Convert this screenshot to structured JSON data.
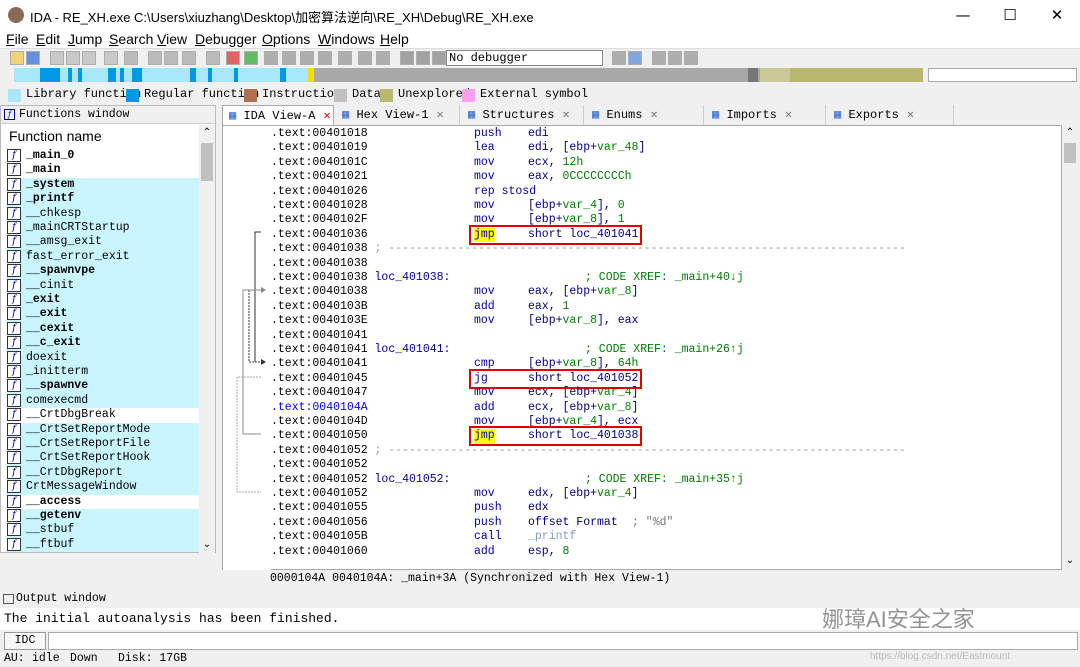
{
  "window": {
    "title": "IDA - RE_XH.exe C:\\Users\\xiuzhang\\Desktop\\加密算法逆向\\RE_XH\\Debug\\RE_XH.exe",
    "minimize": "—",
    "maximize": "☐",
    "close": "✕"
  },
  "menu": [
    {
      "label": "File",
      "u": "F",
      "rest": "ile"
    },
    {
      "label": "Edit",
      "u": "E",
      "rest": "dit"
    },
    {
      "label": "Jump",
      "u": "J",
      "rest": "ump"
    },
    {
      "label": "Search",
      "u": "S",
      "rest": "earch"
    },
    {
      "label": "View",
      "u": "V",
      "rest": "iew"
    },
    {
      "label": "Debugger",
      "u": "D",
      "rest": "ebugger"
    },
    {
      "label": "Options",
      "u": "O",
      "rest": "ptions"
    },
    {
      "label": "Windows",
      "u": "W",
      "rest": "indows"
    },
    {
      "label": "Help",
      "u": "H",
      "rest": "elp"
    }
  ],
  "toolbar": {
    "debugger_select": "No debugger"
  },
  "legend": [
    {
      "label": "Library function",
      "color": "#a8e8f8"
    },
    {
      "label": "Regular function",
      "color": "#0099e6"
    },
    {
      "label": "Instruction",
      "color": "#b07050"
    },
    {
      "label": "Data",
      "color": "#c0c0c0"
    },
    {
      "label": "Unexplored",
      "color": "#b8b870"
    },
    {
      "label": "External symbol",
      "color": "#ff9ff0"
    }
  ],
  "functions_window": {
    "title": "Functions window",
    "header": "Function name",
    "items": [
      {
        "name": "_main_0",
        "lib": false,
        "bold": true
      },
      {
        "name": "_main",
        "lib": false,
        "bold": true
      },
      {
        "name": "_system",
        "lib": true,
        "bold": true
      },
      {
        "name": "_printf",
        "lib": true,
        "bold": true
      },
      {
        "name": "__chkesp",
        "lib": true,
        "bold": false
      },
      {
        "name": "_mainCRTStartup",
        "lib": true,
        "bold": false
      },
      {
        "name": "__amsg_exit",
        "lib": true,
        "bold": false
      },
      {
        "name": "fast_error_exit",
        "lib": true,
        "bold": false
      },
      {
        "name": "__spawnvpe",
        "lib": true,
        "bold": true
      },
      {
        "name": "__cinit",
        "lib": true,
        "bold": false
      },
      {
        "name": "_exit",
        "lib": true,
        "bold": true
      },
      {
        "name": "__exit",
        "lib": true,
        "bold": true
      },
      {
        "name": "__cexit",
        "lib": true,
        "bold": true
      },
      {
        "name": "__c_exit",
        "lib": true,
        "bold": true
      },
      {
        "name": "doexit",
        "lib": true,
        "bold": false
      },
      {
        "name": "_initterm",
        "lib": true,
        "bold": false
      },
      {
        "name": "__spawnve",
        "lib": true,
        "bold": true
      },
      {
        "name": "comexecmd",
        "lib": true,
        "bold": false
      },
      {
        "name": "__CrtDbgBreak",
        "lib": false,
        "bold": false
      },
      {
        "name": "__CrtSetReportMode",
        "lib": true,
        "bold": false
      },
      {
        "name": "__CrtSetReportFile",
        "lib": true,
        "bold": false
      },
      {
        "name": "__CrtSetReportHook",
        "lib": true,
        "bold": false
      },
      {
        "name": "__CrtDbgReport",
        "lib": true,
        "bold": false
      },
      {
        "name": "CrtMessageWindow",
        "lib": true,
        "bold": false
      },
      {
        "name": "__access",
        "lib": false,
        "bold": true
      },
      {
        "name": "__getenv",
        "lib": true,
        "bold": true
      },
      {
        "name": "__stbuf",
        "lib": true,
        "bold": false
      },
      {
        "name": "__ftbuf",
        "lib": true,
        "bold": false
      }
    ]
  },
  "tabs": [
    {
      "label": "IDA View-A",
      "close": "✕",
      "active": true
    },
    {
      "label": "Hex View-1",
      "close": "✕",
      "active": false
    },
    {
      "label": "Structures",
      "close": "✕",
      "active": false
    },
    {
      "label": "Enums",
      "close": "✕",
      "active": false
    },
    {
      "label": "Imports",
      "close": "✕",
      "active": false
    },
    {
      "label": "Exports",
      "close": "✕",
      "active": false
    }
  ],
  "code": [
    {
      "addr": ".text:00401018",
      "mn": "push",
      "op": "edi"
    },
    {
      "addr": ".text:00401019",
      "mn": "lea",
      "op": "edi, [ebp+var_48]"
    },
    {
      "addr": ".text:0040101C",
      "mn": "mov",
      "op": "ecx, 12h"
    },
    {
      "addr": ".text:00401021",
      "mn": "mov",
      "op": "eax, 0CCCCCCCCh"
    },
    {
      "addr": ".text:00401026",
      "mn": "rep stosd",
      "op": ""
    },
    {
      "addr": ".text:00401028",
      "mn": "mov",
      "op": "[ebp+var_4], 0"
    },
    {
      "addr": ".text:0040102F",
      "mn": "mov",
      "op": "[ebp+var_8], 1"
    },
    {
      "addr": ".text:00401036",
      "mn": "jmp",
      "op": "short loc_401041",
      "hl": true,
      "box": true
    },
    {
      "addr": ".text:00401038",
      "sep": "; ---------------------------------------------------------------------------"
    },
    {
      "addr": ".text:00401038"
    },
    {
      "addr": ".text:00401038",
      "label": "loc_401038:",
      "cmt": "; CODE XREF: _main+40↓j"
    },
    {
      "addr": ".text:00401038",
      "mn": "mov",
      "op": "eax, [ebp+var_8]"
    },
    {
      "addr": ".text:0040103B",
      "mn": "add",
      "op": "eax, 1"
    },
    {
      "addr": ".text:0040103E",
      "mn": "mov",
      "op": "[ebp+var_8], eax"
    },
    {
      "addr": ".text:00401041"
    },
    {
      "addr": ".text:00401041",
      "label": "loc_401041:",
      "cmt": "; CODE XREF: _main+26↑j"
    },
    {
      "addr": ".text:00401041",
      "mn": "cmp",
      "op": "[ebp+var_8], 64h"
    },
    {
      "addr": ".text:00401045",
      "mn": "jg",
      "op": "short loc_401052",
      "box": true
    },
    {
      "addr": ".text:00401047",
      "mn": "mov",
      "op": "ecx, [ebp+var_4]"
    },
    {
      "addr": ".text:0040104A",
      "mn": "add",
      "op": "ecx, [ebp+var_8]",
      "blue": true
    },
    {
      "addr": ".text:0040104D",
      "mn": "mov",
      "op": "[ebp+var_4], ecx"
    },
    {
      "addr": ".text:00401050",
      "mn": "jmp",
      "op": "short loc_401038",
      "hl": true,
      "box": true
    },
    {
      "addr": ".text:00401052",
      "sep": "; ---------------------------------------------------------------------------"
    },
    {
      "addr": ".text:00401052"
    },
    {
      "addr": ".text:00401052",
      "label": "loc_401052:",
      "cmt": "; CODE XREF: _main+35↑j"
    },
    {
      "addr": ".text:00401052",
      "mn": "mov",
      "op": "edx, [ebp+var_4]"
    },
    {
      "addr": ".text:00401055",
      "mn": "push",
      "op": "edx"
    },
    {
      "addr": ".text:00401056",
      "mn": "push",
      "op": "offset Format",
      "cmt2": "; \"%d\""
    },
    {
      "addr": ".text:0040105B",
      "mn": "call",
      "op": "_printf"
    },
    {
      "addr": ".text:00401060",
      "mn": "add",
      "op": "esp, 8"
    }
  ],
  "sync_line": "0000104A 0040104A: _main+3A (Synchronized with Hex View-1)",
  "output": {
    "title": "Output window",
    "line": "The initial autoanalysis has been finished."
  },
  "idc": {
    "label": "IDC"
  },
  "status": {
    "au": "AU:",
    "state": "idle",
    "dir": "Down",
    "disk": "Disk: 17GB"
  },
  "watermark": "娜璋AI安全之家",
  "csdn": "https://blog.csdn.net/Eastmount"
}
